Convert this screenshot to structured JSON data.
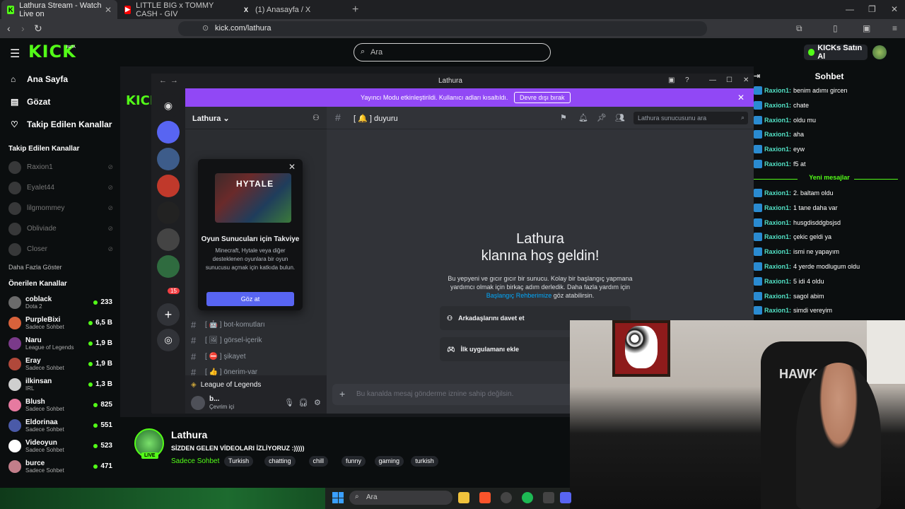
{
  "browser": {
    "tabs": [
      {
        "title": "Lathura Stream - Watch Live on",
        "favicon": "K",
        "color": "#53fc18"
      },
      {
        "title": "LITTLE BIG x TOMMY CASH - GIV",
        "favicon": "▶",
        "color": "#ff0000"
      },
      {
        "title": "(1) Anasayfa / X",
        "favicon": "X",
        "color": "#000000"
      }
    ],
    "url": "kick.com/lathura"
  },
  "kick": {
    "logo": "KICK",
    "beta": "BETA",
    "search_placeholder": "Ara",
    "buy_label": "KICKs Satın Al",
    "nav": [
      {
        "label": "Ana Sayfa",
        "icon": "home-icon",
        "glyph": "⌂"
      },
      {
        "label": "Gözat",
        "icon": "browse-icon",
        "glyph": "▤"
      },
      {
        "label": "Takip Edilen Kanallar",
        "icon": "heart-icon",
        "glyph": "♡"
      }
    ],
    "followed_heading": "Takip Edilen Kanallar",
    "followed": [
      "Raxion1",
      "Eyalet44",
      "lilgmommey",
      "Obliviade",
      "Closer"
    ],
    "show_more": "Daha Fazla Göster",
    "recommended_heading": "Önerilen Kanallar",
    "recommended": [
      {
        "name": "coblack",
        "category": "Dota 2",
        "viewers": "233",
        "color": "#6b6b6b"
      },
      {
        "name": "PurpleBixi",
        "category": "Sadece Sohbet",
        "viewers": "6,5 B",
        "color": "#d8623b"
      },
      {
        "name": "Naru",
        "category": "League of Legends",
        "viewers": "1,9 B",
        "color": "#7a3a8a"
      },
      {
        "name": "Eray",
        "category": "Sadece Sohbet",
        "viewers": "1,9 B",
        "color": "#b0483a"
      },
      {
        "name": "ilkinsan",
        "category": "IRL",
        "viewers": "1,3 B",
        "color": "#cfcfcf"
      },
      {
        "name": "Blush",
        "category": "Sadece Sohbet",
        "viewers": "825",
        "color": "#e67aa0"
      },
      {
        "name": "Eldorinaa",
        "category": "Sadece Sohbet",
        "viewers": "551",
        "color": "#4a5aa8"
      },
      {
        "name": "Videoyun",
        "category": "Sadece Sohbet",
        "viewers": "523",
        "color": "#ffffff"
      },
      {
        "name": "burce",
        "category": "Sadece Sohbet",
        "viewers": "471",
        "color": "#c27e8a"
      }
    ]
  },
  "discord": {
    "window_title": "Lathura",
    "banner_text": "Yayıncı Modu etkinleştirildi. Kullanıcı adları kısaltıldı.",
    "banner_button": "Devre dışı bırak",
    "server_name": "Lathura",
    "channel_name": "[ 🔔 ] duyuru",
    "search_placeholder": "Lathura sunucusunu ara",
    "channels": [
      "bot-komutları",
      "görsel-içerik",
      "şikayet",
      "önerim-var"
    ],
    "voice_channel": "League of Legends",
    "user_name": "b...",
    "user_status": "Çevrim içi",
    "badge": "15",
    "popup": {
      "art_logo": "HYTALE",
      "title": "Oyun Sunucuları için Takviye",
      "desc": "Minecraft, Hytale veya diğer desteklenen oyunlara bir oyun sunucusu açmak için katkıda bulun.",
      "button": "Göz at"
    },
    "welcome_line1": "Lathura",
    "welcome_line2": "klanına hoş geldin!",
    "welcome_desc": "Bu yepyeni ve gıcır gıcır bir sunucu. Kolay bir başlangıç yapmana yardımcı olmak için birkaç adım derledik. Daha fazla yardım için",
    "welcome_link": "Başlangıç Rehberimize",
    "welcome_tail": "göz atabilirsin.",
    "actions": [
      "Arkadaşlarını davet et",
      "İlk uygulamanı ekle"
    ],
    "message_placeholder": "Bu kanalda mesaj gönderme iznine sahip değilsin."
  },
  "chat": {
    "title": "Sohbet",
    "new_messages": "Yeni mesajlar",
    "messages_before": [
      {
        "user": "Raxion1:",
        "text": "benim adımı gircen"
      },
      {
        "user": "Raxion1:",
        "text": "chate"
      },
      {
        "user": "Raxion1:",
        "text": "oldu mu"
      },
      {
        "user": "Raxion1:",
        "text": "aha"
      },
      {
        "user": "Raxion1:",
        "text": "eyw"
      },
      {
        "user": "Raxion1:",
        "text": "f5 at"
      }
    ],
    "messages_after": [
      {
        "user": "Raxion1:",
        "text": "2. baltam oldu"
      },
      {
        "user": "Raxion1:",
        "text": "1 tane daha var"
      },
      {
        "user": "Raxion1:",
        "text": "husgdisddgbsjsd"
      },
      {
        "user": "Raxion1:",
        "text": "çekic geldi ya"
      },
      {
        "user": "Raxion1:",
        "text": "ismi ne yapayım"
      },
      {
        "user": "Raxion1:",
        "text": "4 yerde modlugum oldu"
      },
      {
        "user": "Raxion1:",
        "text": "5 idi 4 oldu"
      },
      {
        "user": "Raxion1:",
        "text": "sagol abim"
      },
      {
        "user": "Raxion1:",
        "text": "simdi vereyim"
      }
    ]
  },
  "stream": {
    "streamer": "Lathura",
    "live": "LIVE",
    "title": "SİZDEN GELEN VİDEOLARI İZLİYORUZ :)))))",
    "category": "Sadece Sohbet",
    "tags": [
      "Turkish",
      "chatting",
      "chill",
      "funny",
      "gaming",
      "turkish"
    ],
    "chair_brand": "HAWK"
  },
  "taskbar": {
    "search_placeholder": "Ara"
  }
}
